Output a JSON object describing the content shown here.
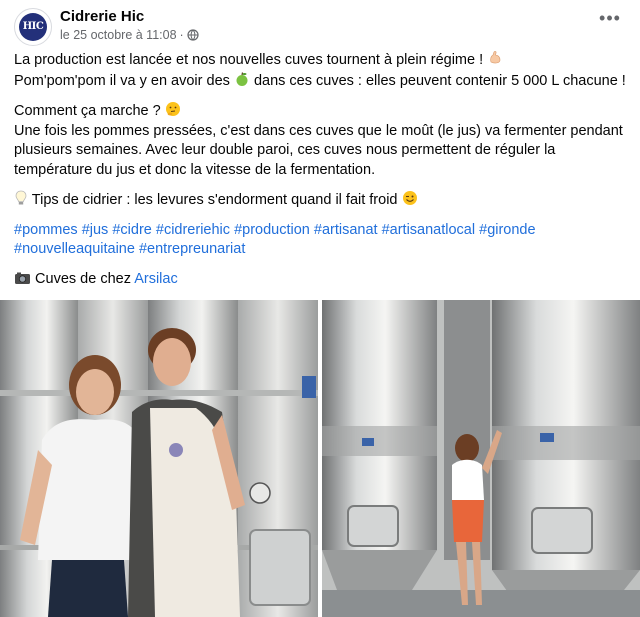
{
  "post": {
    "page_name": "Cidrerie Hic",
    "avatar_text": "HIC",
    "timestamp": "le 25 octobre à 11:08",
    "dot": "·",
    "more_label": "•••"
  },
  "body": {
    "line1": "La production est lancée et nos nouvelles cuves tournent à plein régime !",
    "line2a": "Pom'pom'pom il va y en avoir des",
    "line2b": "dans ces cuves : elles peuvent contenir 5 000 L chacune !",
    "line3": "Comment ça marche ?",
    "line4": "Une fois les pommes pressées, c'est dans ces cuves que le moût (le jus) va fermenter pendant plusieurs semaines. Avec leur double paroi, ces cuves nous permettent de réguler la température du jus et donc la vitesse de la fermentation.",
    "line5": "Tips de cidrier : les levures s'endorment quand il fait froid",
    "hashtags": [
      "#pommes",
      "#jus",
      "#cidre",
      "#cidreriehic",
      "#production",
      "#artisanat",
      "#artisanatlocal",
      "#gironde",
      "#nouvelleaquitaine",
      "#entrepreunariat"
    ],
    "credit_prefix": "Cuves de chez",
    "credit_link": "Arsilac"
  },
  "icons": {
    "flexed-biceps": "flexed-biceps-icon",
    "green-apple": "green-apple-icon",
    "thinking-face": "thinking-face-icon",
    "light-bulb": "light-bulb-icon",
    "wink-face": "wink-face-icon",
    "camera": "camera-icon",
    "globe": "globe-icon"
  },
  "colors": {
    "link": "#216fdb",
    "meta": "#65676b",
    "text": "#050505",
    "avatar_bg": "#23307a"
  }
}
